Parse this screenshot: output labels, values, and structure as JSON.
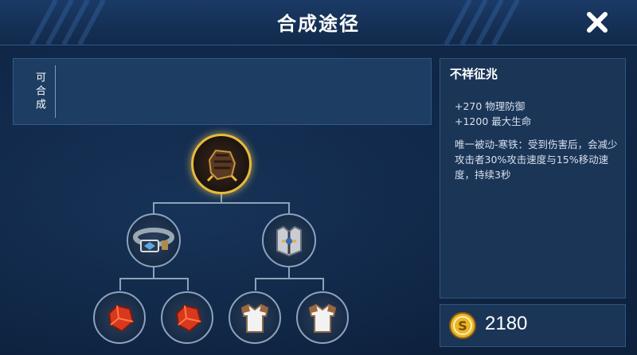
{
  "header": {
    "title": "合成途径"
  },
  "craftable": {
    "label": "可合成"
  },
  "item": {
    "name": "不祥征兆",
    "stats": [
      "+270 物理防御",
      "+1200 最大生命"
    ],
    "passive": "唯一被动-寒铁：受到伤害后，会减少攻击者30%攻击速度与15%移动速度，持续3秒",
    "price": "2180"
  },
  "tree": {
    "main": "fist-armor-icon",
    "components": [
      "belt-icon",
      "chest-armor-icon"
    ],
    "leaves": [
      "red-crystal-icon",
      "red-crystal-icon",
      "cloth-armor-icon",
      "cloth-armor-icon"
    ]
  },
  "colors": {
    "gold": "#e7bb3a",
    "panel": "#1b3557",
    "line": "#8ea2b8"
  }
}
